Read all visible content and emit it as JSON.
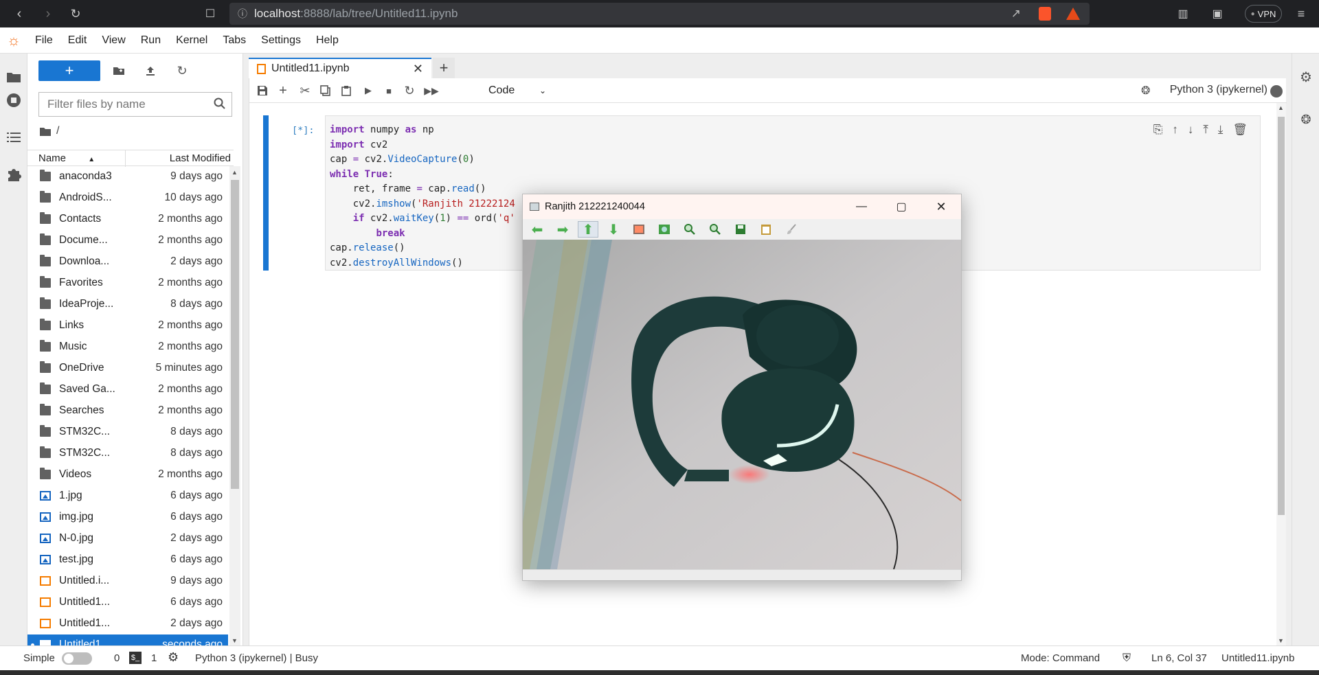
{
  "browser": {
    "url_host": "localhost",
    "url_path": ":8888/lab/tree/Untitled11.ipynb",
    "vpn_label": "VPN"
  },
  "menu": [
    "File",
    "Edit",
    "View",
    "Run",
    "Kernel",
    "Tabs",
    "Settings",
    "Help"
  ],
  "filebrowser": {
    "new_label": "+",
    "filter_placeholder": "Filter files by name",
    "breadcrumb": "/",
    "col_name": "Name",
    "col_modified": "Last Modified",
    "rows": [
      {
        "name": "anaconda3",
        "modified": "9 days ago",
        "type": "folder"
      },
      {
        "name": "AndroidS...",
        "modified": "10 days ago",
        "type": "folder"
      },
      {
        "name": "Contacts",
        "modified": "2 months ago",
        "type": "folder"
      },
      {
        "name": "Docume...",
        "modified": "2 months ago",
        "type": "folder"
      },
      {
        "name": "Downloa...",
        "modified": "2 days ago",
        "type": "folder"
      },
      {
        "name": "Favorites",
        "modified": "2 months ago",
        "type": "folder"
      },
      {
        "name": "IdeaProje...",
        "modified": "8 days ago",
        "type": "folder"
      },
      {
        "name": "Links",
        "modified": "2 months ago",
        "type": "folder"
      },
      {
        "name": "Music",
        "modified": "2 months ago",
        "type": "folder"
      },
      {
        "name": "OneDrive",
        "modified": "5 minutes ago",
        "type": "folder"
      },
      {
        "name": "Saved Ga...",
        "modified": "2 months ago",
        "type": "folder"
      },
      {
        "name": "Searches",
        "modified": "2 months ago",
        "type": "folder"
      },
      {
        "name": "STM32C...",
        "modified": "8 days ago",
        "type": "folder"
      },
      {
        "name": "STM32C...",
        "modified": "8 days ago",
        "type": "folder"
      },
      {
        "name": "Videos",
        "modified": "2 months ago",
        "type": "folder"
      },
      {
        "name": "1.jpg",
        "modified": "6 days ago",
        "type": "image"
      },
      {
        "name": "img.jpg",
        "modified": "6 days ago",
        "type": "image"
      },
      {
        "name": "N-0.jpg",
        "modified": "2 days ago",
        "type": "image"
      },
      {
        "name": "test.jpg",
        "modified": "6 days ago",
        "type": "image"
      },
      {
        "name": "Untitled.i...",
        "modified": "9 days ago",
        "type": "notebook"
      },
      {
        "name": "Untitled1...",
        "modified": "6 days ago",
        "type": "notebook"
      },
      {
        "name": "Untitled1...",
        "modified": "2 days ago",
        "type": "notebook"
      },
      {
        "name": "Untitled1...",
        "modified": "seconds ago",
        "type": "notebook",
        "selected": true
      }
    ]
  },
  "notebook": {
    "tab_title": "Untitled11.ipynb",
    "cell_type": "Code",
    "kernel": "Python 3 (ipykernel)",
    "prompt": "[*]:",
    "code": [
      "import numpy as np",
      "import cv2",
      "cap = cv2.VideoCapture(0)",
      "while True:",
      "    ret, frame = cap.read()",
      "    cv2.imshow('Ranjith 21222124",
      "    if cv2.waitKey(1) == ord('q'",
      "        break",
      "cap.release()",
      "cv2.destroyAllWindows()"
    ]
  },
  "cv_window": {
    "title": "Ranjith 212221240044"
  },
  "status": {
    "simple_label": "Simple",
    "count_zero": "0",
    "count_one": "1",
    "kernel_status": "Python 3 (ipykernel) | Busy",
    "mode": "Mode: Command",
    "position": "Ln 6, Col 37",
    "file": "Untitled11.ipynb"
  },
  "colors": {
    "accent": "#1976d2",
    "browser_bg": "#202124",
    "notebook_icon": "#f57c00"
  }
}
